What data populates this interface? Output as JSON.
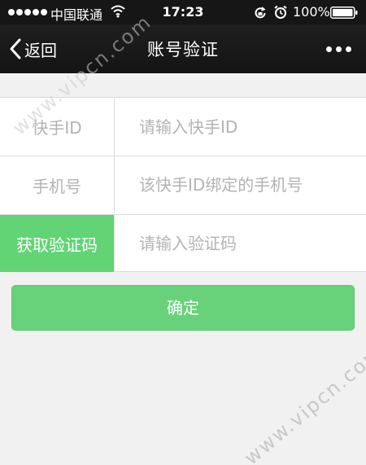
{
  "status_bar": {
    "carrier": "中国联通",
    "time": "17:23",
    "battery": "100%"
  },
  "nav": {
    "back_label": "返回",
    "title": "账号验证"
  },
  "form": {
    "rows": [
      {
        "label": "快手ID",
        "placeholder": "请输入快手ID"
      },
      {
        "label": "手机号",
        "placeholder": "该快手ID绑定的手机号"
      },
      {
        "label": "获取验证码",
        "placeholder": "请输入验证码"
      }
    ]
  },
  "confirm_label": "确定",
  "watermark": "www.vipcn.com",
  "colors": {
    "accent_green": "#62d476",
    "bar_dark": "#161616"
  }
}
